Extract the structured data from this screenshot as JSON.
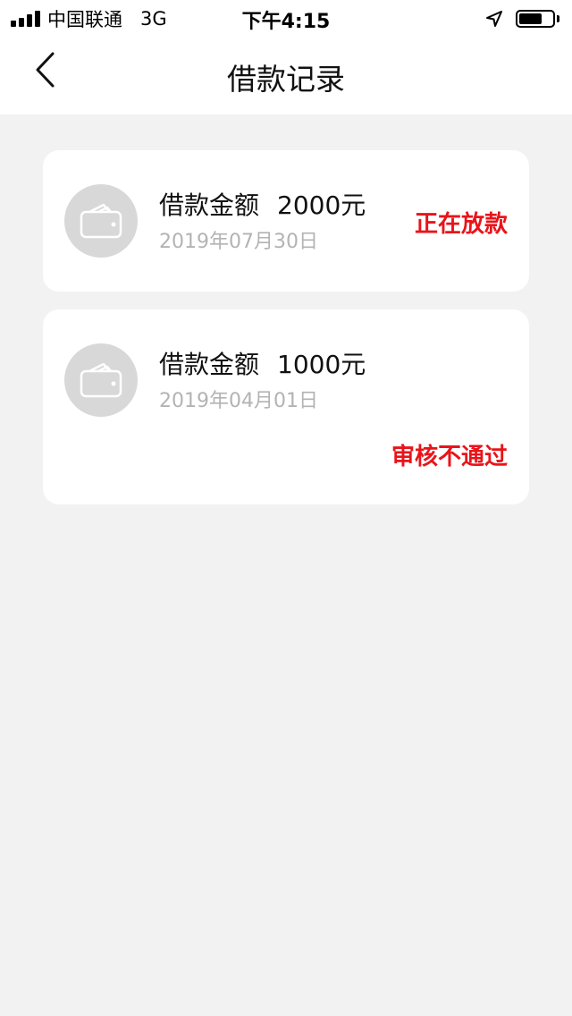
{
  "status_bar": {
    "carrier": "中国联通",
    "network": "3G",
    "time": "下午4:15",
    "battery_level": 0.7
  },
  "nav": {
    "title": "借款记录"
  },
  "records": [
    {
      "amount_label": "借款金额",
      "amount": "2000元",
      "date": "2019年07月30日",
      "status": "正在放款"
    },
    {
      "amount_label": "借款金额",
      "amount": "1000元",
      "date": "2019年04月01日",
      "status": "审核不通过"
    }
  ],
  "colors": {
    "status_red": "#e8141a",
    "date_gray": "#b3b3b3",
    "background": "#f2f2f2"
  },
  "icons": {
    "back": "chevron-left-icon",
    "record": "wallet-icon",
    "location": "location-arrow-icon"
  }
}
